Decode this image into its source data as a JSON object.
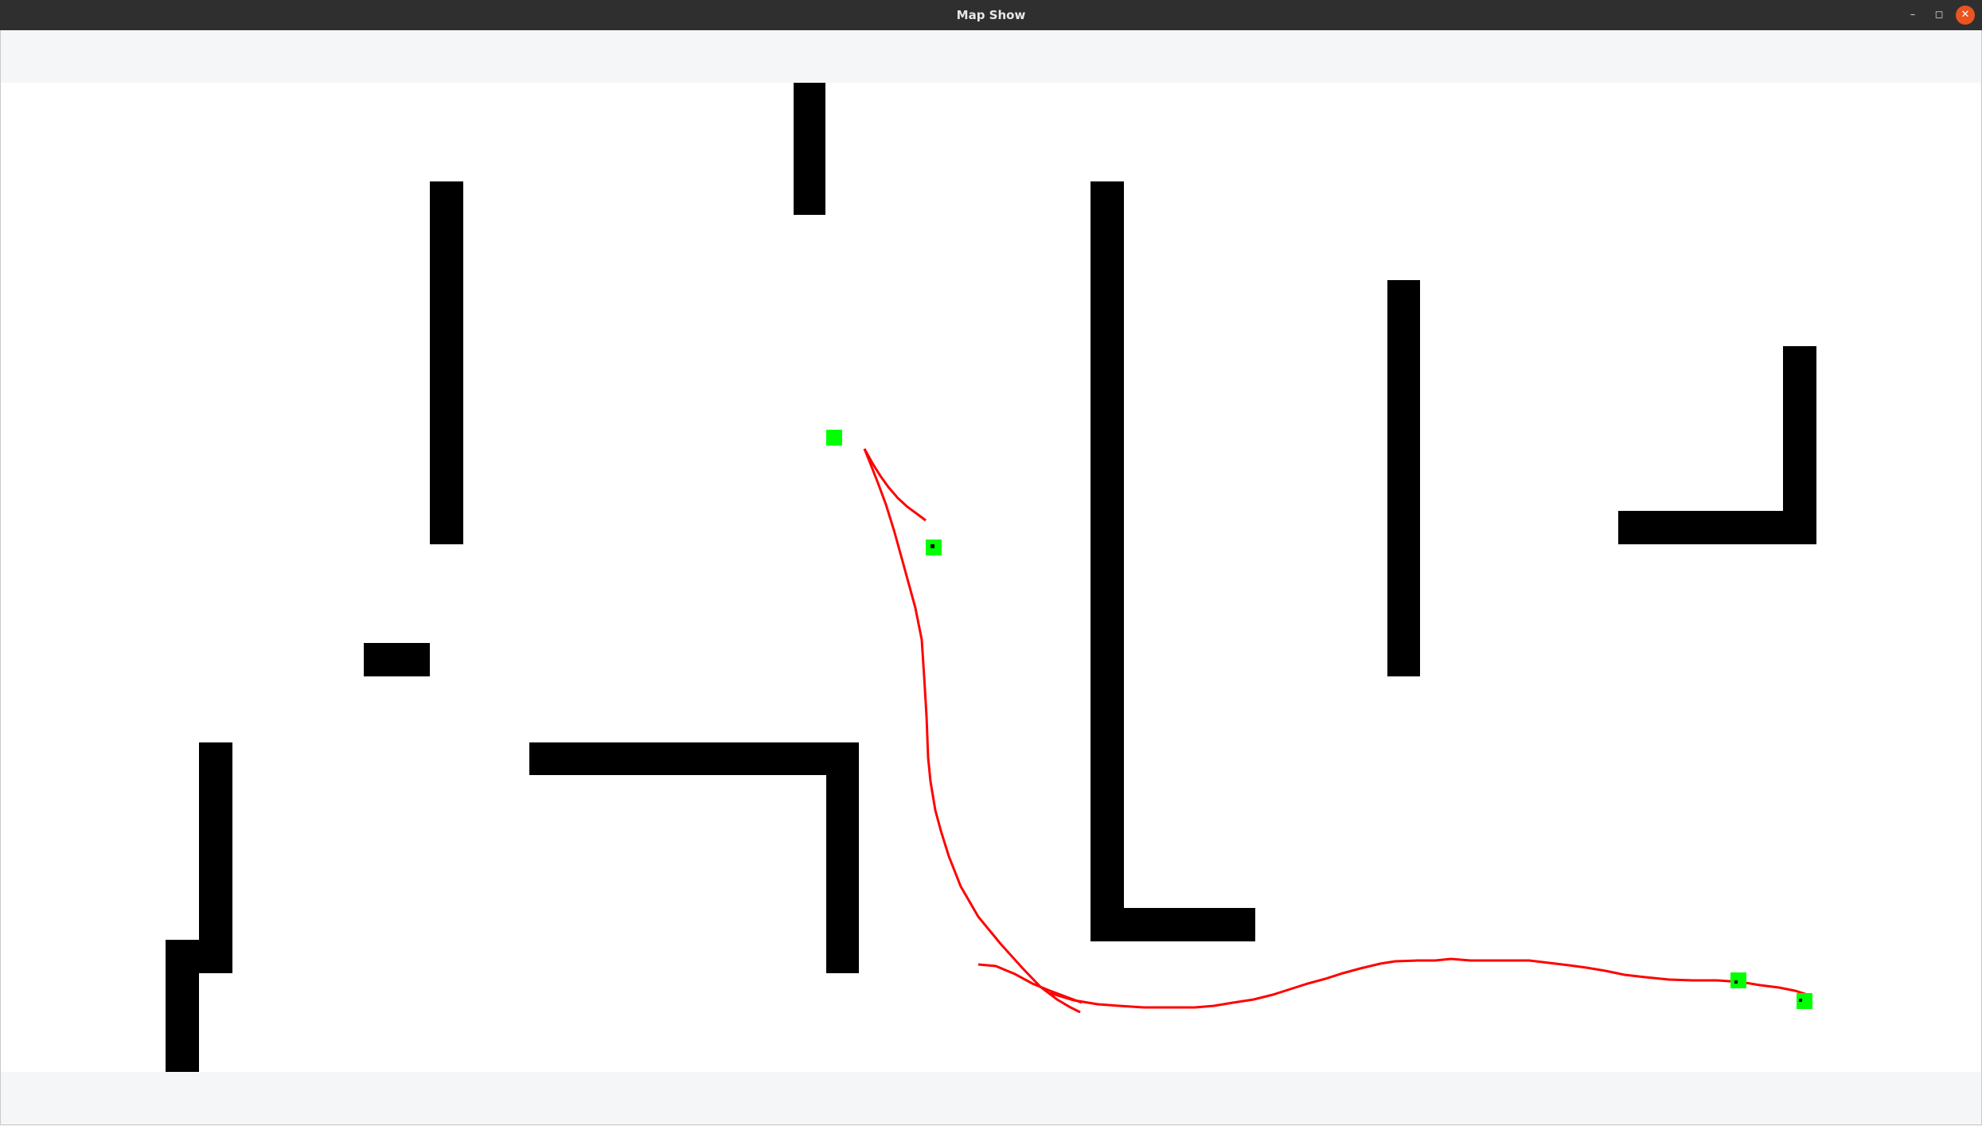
{
  "window": {
    "title": "Map Show",
    "controls": {
      "minimize_icon": "minimize-icon",
      "maximize_icon": "maximize-icon",
      "close_icon": "close-icon",
      "minimize_glyph": "–",
      "maximize_glyph": "◻",
      "close_glyph": "✕"
    }
  },
  "map": {
    "colors": {
      "background": "#ffffff",
      "obstacle": "#000000",
      "path": "#ff0000",
      "waypoint": "#00ff00"
    }
  }
}
